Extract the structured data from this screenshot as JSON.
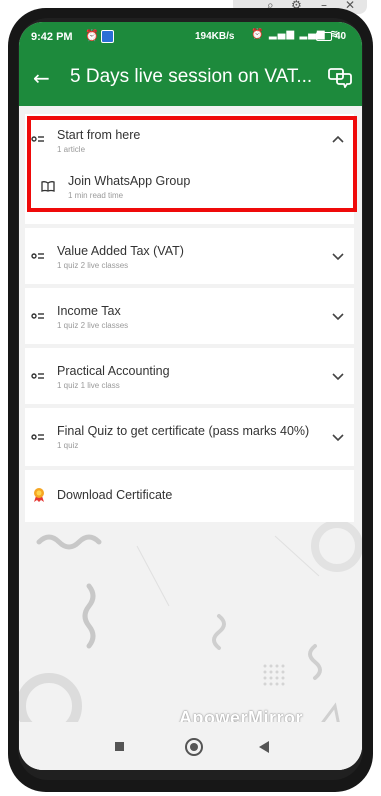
{
  "status_bar": {
    "time": "9:42 PM",
    "network_rate": "194KB/s",
    "battery_percent": "40",
    "battery_level_fraction": 0.4
  },
  "app_bar": {
    "title": "5 Days live session on VAT...",
    "back_icon": "arrow-left-icon",
    "chat_icon": "chat-bubbles-icon"
  },
  "sections": [
    {
      "title": "Start from here",
      "meta": "1 article",
      "expanded": true,
      "items": [
        {
          "title": "Join WhatsApp Group",
          "meta": "1 min read time",
          "icon": "book-icon"
        }
      ]
    },
    {
      "title": "Value Added Tax (VAT)",
      "meta": "1 quiz 2 live classes",
      "expanded": false
    },
    {
      "title": "Income Tax",
      "meta": "1 quiz 2 live classes",
      "expanded": false
    },
    {
      "title": "Practical Accounting",
      "meta": "1 quiz 1 live class",
      "expanded": false
    },
    {
      "title": "Final Quiz to get certificate (pass marks 40%)",
      "meta": "1 quiz",
      "expanded": false
    }
  ],
  "download": {
    "label": "Download Certificate",
    "icon": "certificate-ribbon-icon"
  },
  "watermark": "ApowerMirror",
  "colors": {
    "header_green": "#1d8a3c",
    "highlight_red": "#ef0a0a"
  }
}
